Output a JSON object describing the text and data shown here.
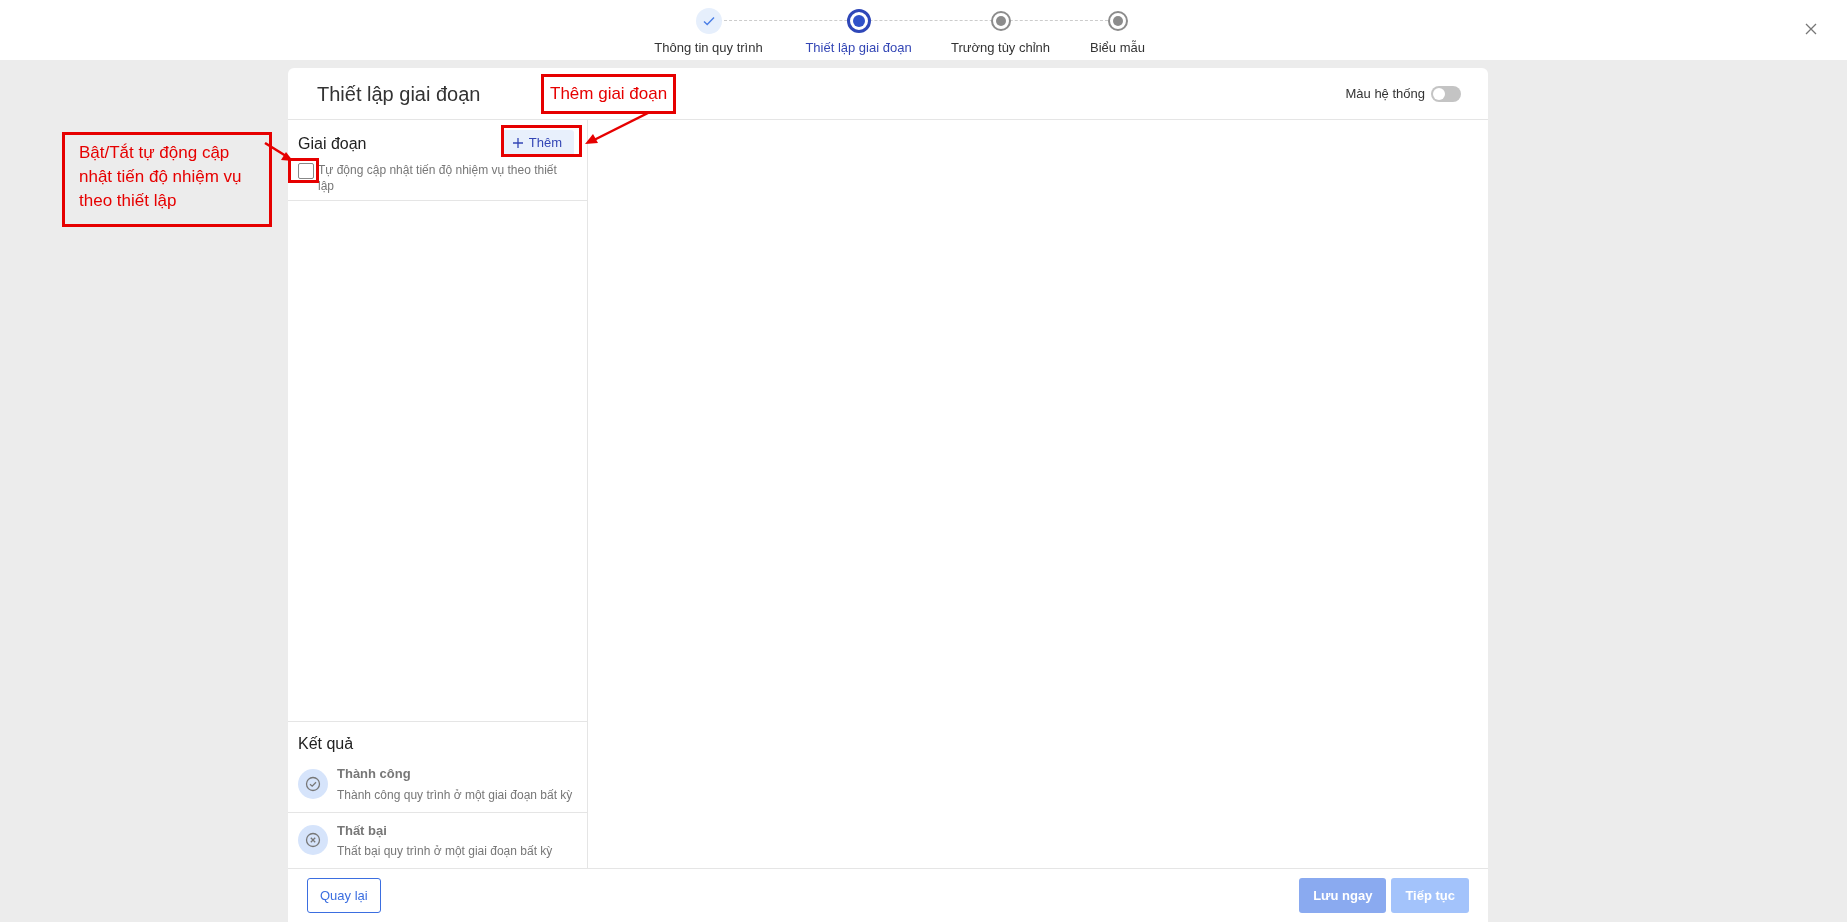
{
  "stepper": [
    {
      "label": "Thông tin quy trình",
      "kind": "done",
      "selected": false
    },
    {
      "label": "Thiết lập giai đoạn",
      "kind": "current",
      "selected": true
    },
    {
      "label": "Trường tùy chỉnh",
      "kind": "pending",
      "selected": false
    },
    {
      "label": "Biểu mẫu",
      "kind": "pending",
      "selected": false
    }
  ],
  "panel": {
    "title": "Thiết lập giai đoạn",
    "system_color": {
      "label": "Màu hệ thống",
      "on": false
    }
  },
  "stages": {
    "title": "Giai đoạn",
    "add_button": "Thêm",
    "auto_update": {
      "label": "Tự động cập nhật tiến độ nhiệm vụ theo thiết lập",
      "checked": false
    }
  },
  "results": {
    "title": "Kết quả",
    "items": [
      {
        "kind": "success",
        "name": "Thành công",
        "description": "Thành công quy trình ở một giai đoạn bất kỳ"
      },
      {
        "kind": "failure",
        "name": "Thất bại",
        "description": "Thất bại quy trình ở một giai đoạn bất kỳ"
      }
    ]
  },
  "footer": {
    "back": "Quay lại",
    "buttons": [
      {
        "label": "Lưu ngay",
        "disabled": true
      },
      {
        "label": "Tiếp tục",
        "disabled": true
      }
    ]
  },
  "annotations": [
    {
      "kind": "add",
      "text": "Thêm giai đoạn"
    },
    {
      "kind": "checkbox",
      "text": "Bật/Tắt tự động cập nhật tiến độ nhiệm vụ theo thiết lập"
    }
  ]
}
